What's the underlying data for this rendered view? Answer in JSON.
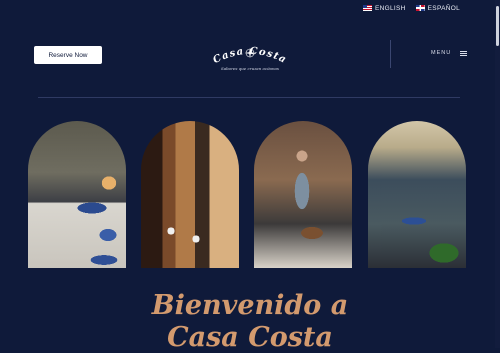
{
  "topbar": {
    "languages": [
      {
        "label": "ENGLISH",
        "flag": "us-flag-icon"
      },
      {
        "label": "ESPAÑOL",
        "flag": "dominican-flag-icon"
      }
    ]
  },
  "header": {
    "reserve_label": "Reserve Now",
    "logo_text": "Casa Costa",
    "logo_tagline": "Sabores que cruzan océanos",
    "menu_label": "MENU"
  },
  "hero": {
    "line1": "Bienvenido a",
    "line2": "Casa Costa"
  },
  "gallery": [
    {
      "name": "dessert-table-photo"
    },
    {
      "name": "wine-wall-dining-room-photo"
    },
    {
      "name": "chef-serving-dish-photo"
    },
    {
      "name": "patio-dining-photo"
    }
  ],
  "colors": {
    "background": "#0f1a3a",
    "heading_accent": "#d39a6e",
    "button_bg": "#ffffff"
  }
}
